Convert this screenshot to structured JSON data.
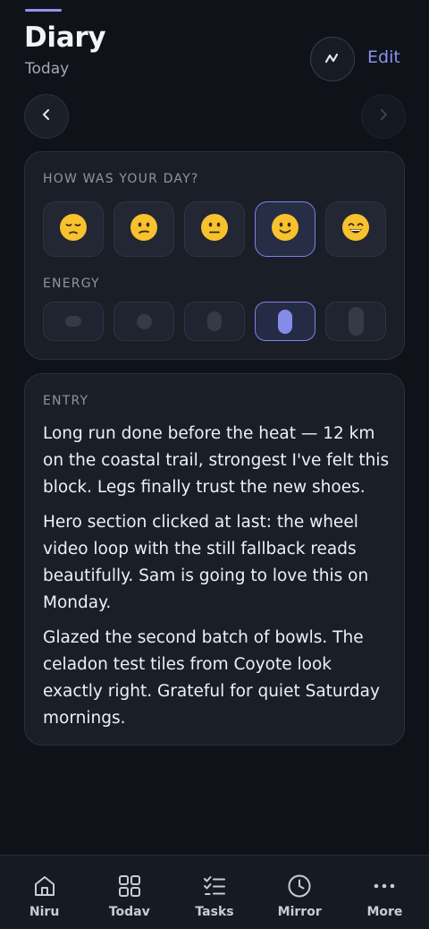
{
  "header": {
    "title": "Diary",
    "subtitle": "Today",
    "edit_label": "Edit"
  },
  "mood": {
    "label": "HOW WAS YOUR DAY?",
    "options": [
      "😔",
      "😕",
      "😐",
      "🙂",
      "😄"
    ],
    "selected_index": 3
  },
  "energy": {
    "label": "ENERGY",
    "levels": 5,
    "selected_index": 3
  },
  "entry": {
    "label": "ENTRY",
    "paragraphs": [
      "Long run done before the heat — 12 km on the coastal trail, strongest I've felt this block. Legs finally trust the new shoes.",
      "Hero section clicked at last: the wheel video loop with the still fallback reads beautifully. Sam is going to love this on Monday.",
      "Glazed the second batch of bowls. The celadon test tiles from Coyote look exactly right. Grateful for quiet Saturday mornings."
    ]
  },
  "tabbar": {
    "items": [
      {
        "label": "Niru",
        "icon": "home-icon"
      },
      {
        "label": "Todav",
        "icon": "grid-icon"
      },
      {
        "label": "Tasks",
        "icon": "checklist-icon"
      },
      {
        "label": "Mirror",
        "icon": "clock-icon"
      },
      {
        "label": "More",
        "icon": "more-icon"
      }
    ]
  },
  "colors": {
    "background": "#0f1218",
    "card": "#1a1e27",
    "accent": "#8a92ee",
    "selected_border": "#7c83e3"
  }
}
